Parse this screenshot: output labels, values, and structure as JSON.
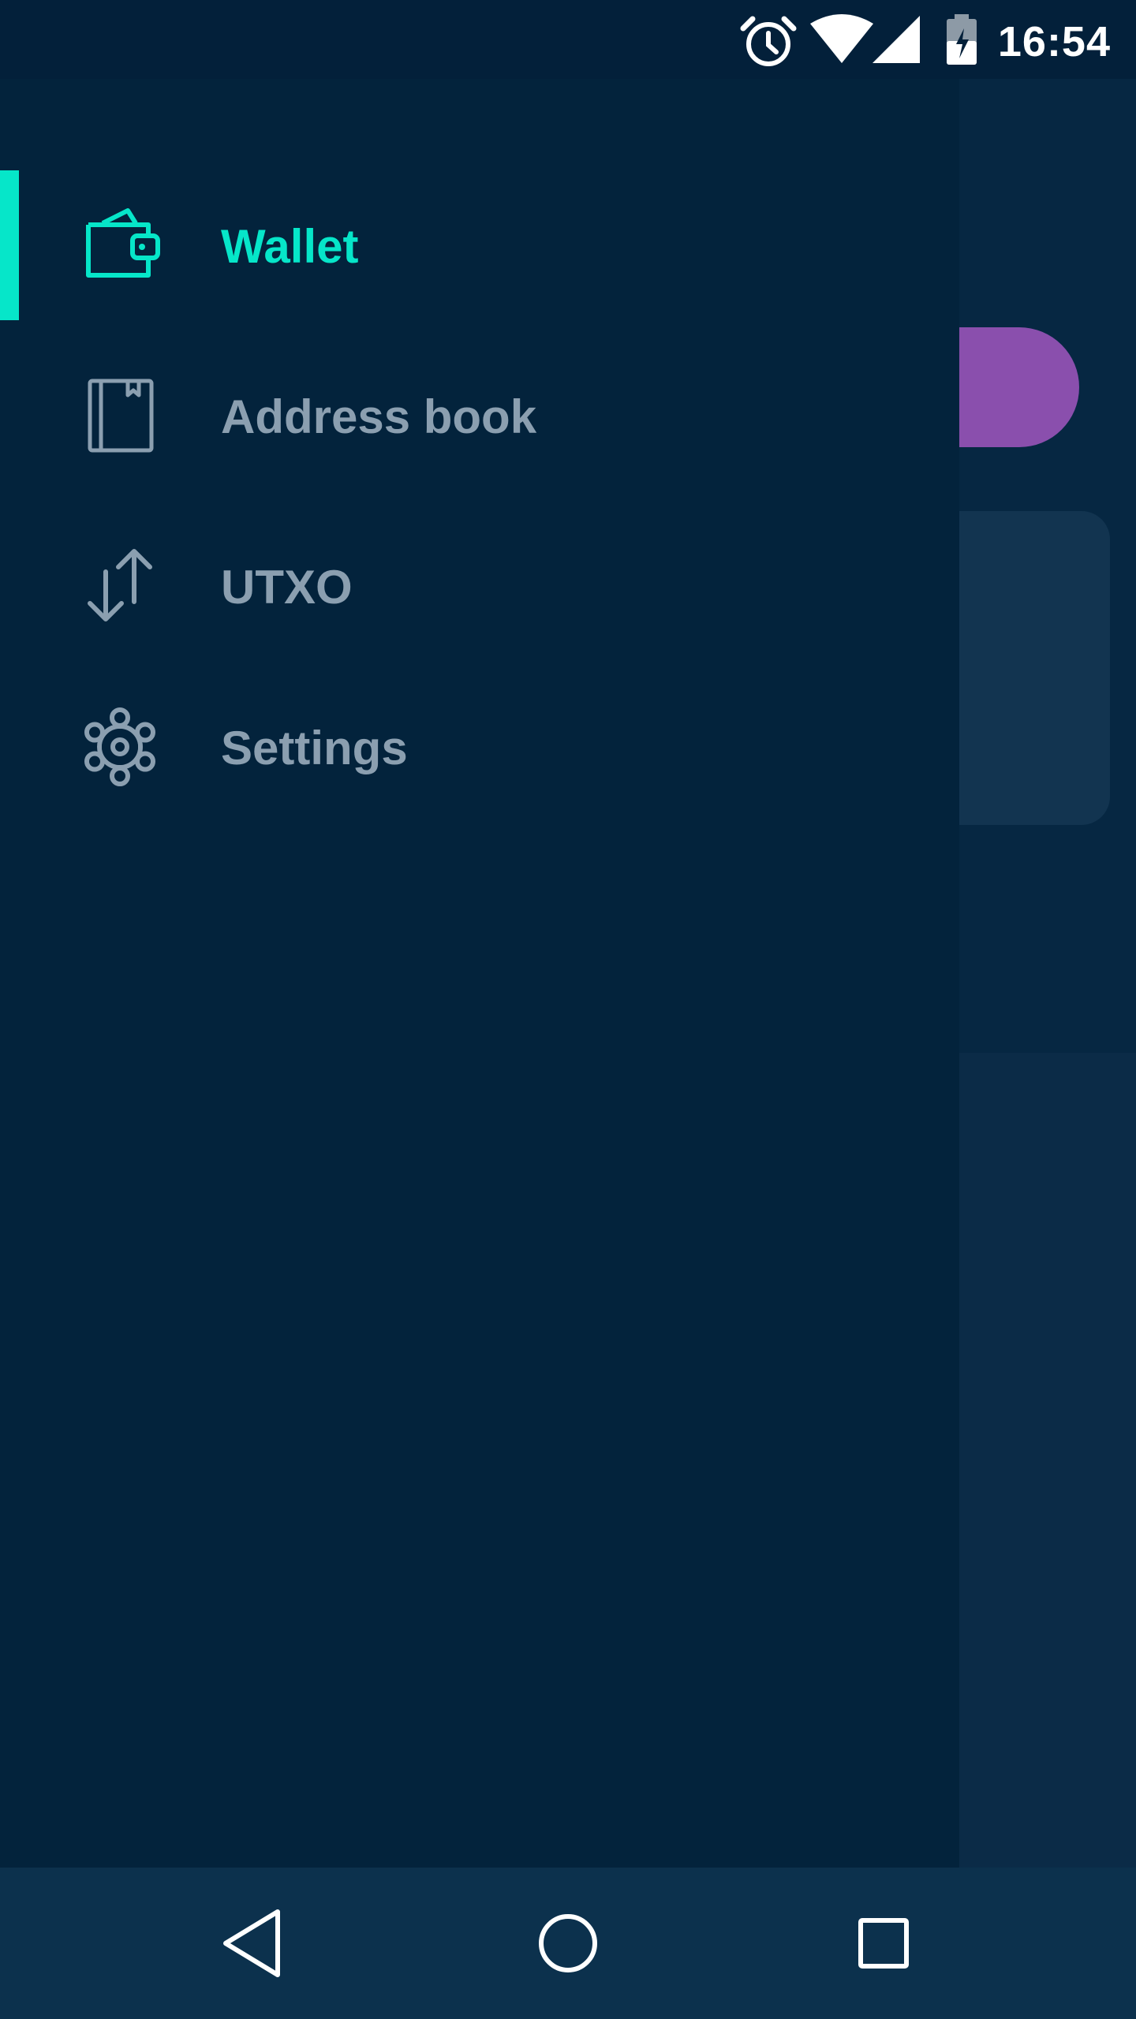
{
  "status_bar": {
    "time": "16:54",
    "icons": [
      "alarm-icon",
      "wifi-icon",
      "signal-icon",
      "battery-charging-icon"
    ]
  },
  "colors": {
    "accent": "#06e6c9",
    "drawer_background": "#03233c",
    "inactive_text": "#8b9fb0",
    "purple_button": "#8a4fad"
  },
  "drawer": {
    "items": [
      {
        "label": "Wallet",
        "icon": "wallet-icon",
        "active": true
      },
      {
        "label": "Address book",
        "icon": "address-book-icon",
        "active": false
      },
      {
        "label": "UTXO",
        "icon": "transfer-arrows-icon",
        "active": false
      },
      {
        "label": "Settings",
        "icon": "gear-icon",
        "active": false
      }
    ]
  },
  "navigation_bar": {
    "buttons": [
      "back-icon",
      "home-icon",
      "recents-icon"
    ]
  }
}
